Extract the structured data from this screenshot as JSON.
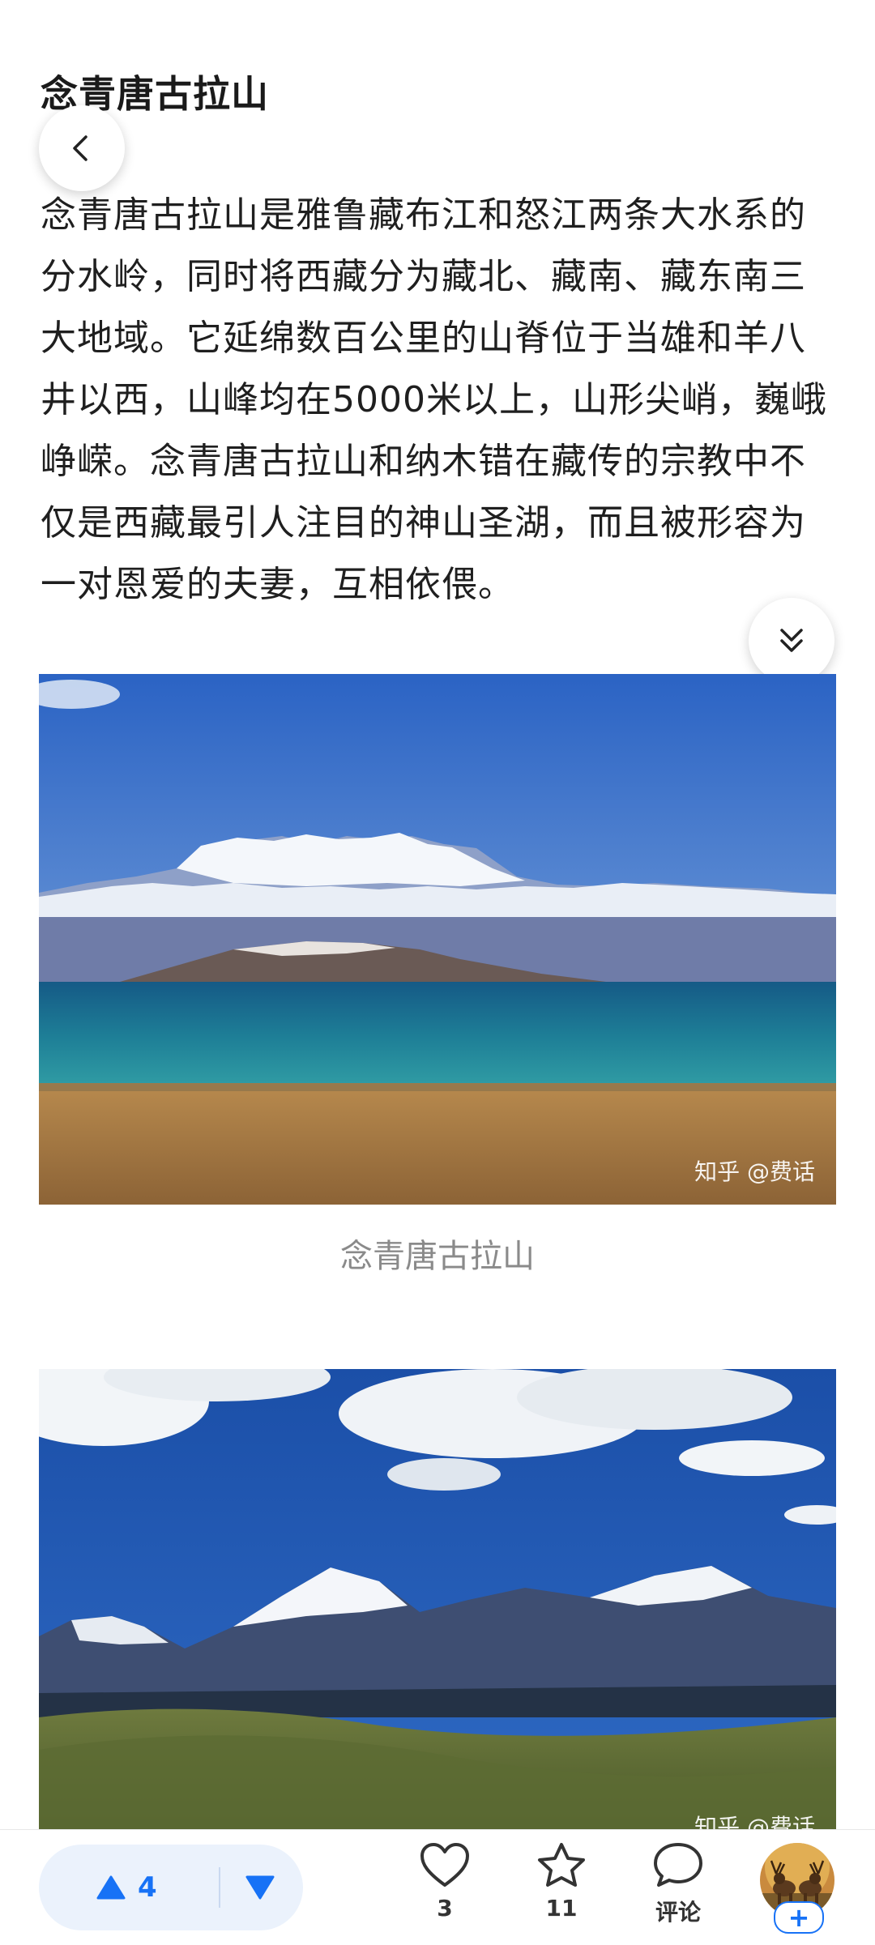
{
  "article": {
    "heading": "念青唐古拉山",
    "paragraph": "念青唐古拉山是雅鲁藏布江和怒江两条大水系的分水岭，同时将西藏分为藏北、藏南、藏东南三大地域。它延绵数百公里的山脊位于当雄和羊八井以西，山峰均在5000米以上，山形尖峭，巍峨峥嵘。念青唐古拉山和纳木错在藏传的宗教中不仅是西藏最引人注目的神山圣湖，而且被形容为一对恩爱的夫妻，互相依偎。",
    "image1": {
      "watermark": "知乎 @费话",
      "caption": "念青唐古拉山"
    },
    "image2": {
      "watermark": "知乎 @费话"
    }
  },
  "icons": {
    "back": "chevron-left-icon",
    "collapse": "double-chevron-down-icon",
    "upvote": "triangle-up-icon",
    "downvote": "triangle-down-icon",
    "like": "heart-icon",
    "favorite": "star-icon",
    "comment": "speech-bubble-icon"
  },
  "bottom_bar": {
    "upvote_count": "4",
    "like_count": "3",
    "favorite_count": "11",
    "comment_label": "评论",
    "follow_plus": "+"
  },
  "colors": {
    "accent": "#1772f6",
    "vote_bg": "#ebf2fc",
    "caption": "#8a8a8a"
  }
}
